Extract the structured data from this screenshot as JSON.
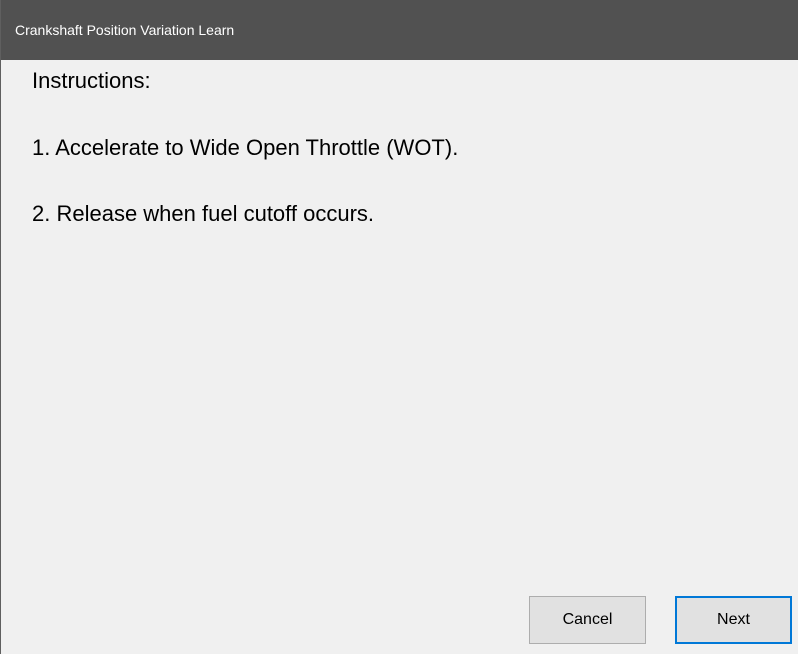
{
  "window": {
    "title": "Crankshaft Position Variation Learn"
  },
  "instructions": {
    "heading": "Instructions:",
    "steps": [
      "1. Accelerate to Wide Open Throttle (WOT).",
      "2. Release when fuel cutoff occurs."
    ]
  },
  "buttons": {
    "cancel_label": "Cancel",
    "next_label": "Next"
  },
  "colors": {
    "titlebar_background": "#515151",
    "titlebar_text": "#ffffff",
    "dialog_background": "#f0f0f0",
    "default_button_border": "#0078d7"
  }
}
